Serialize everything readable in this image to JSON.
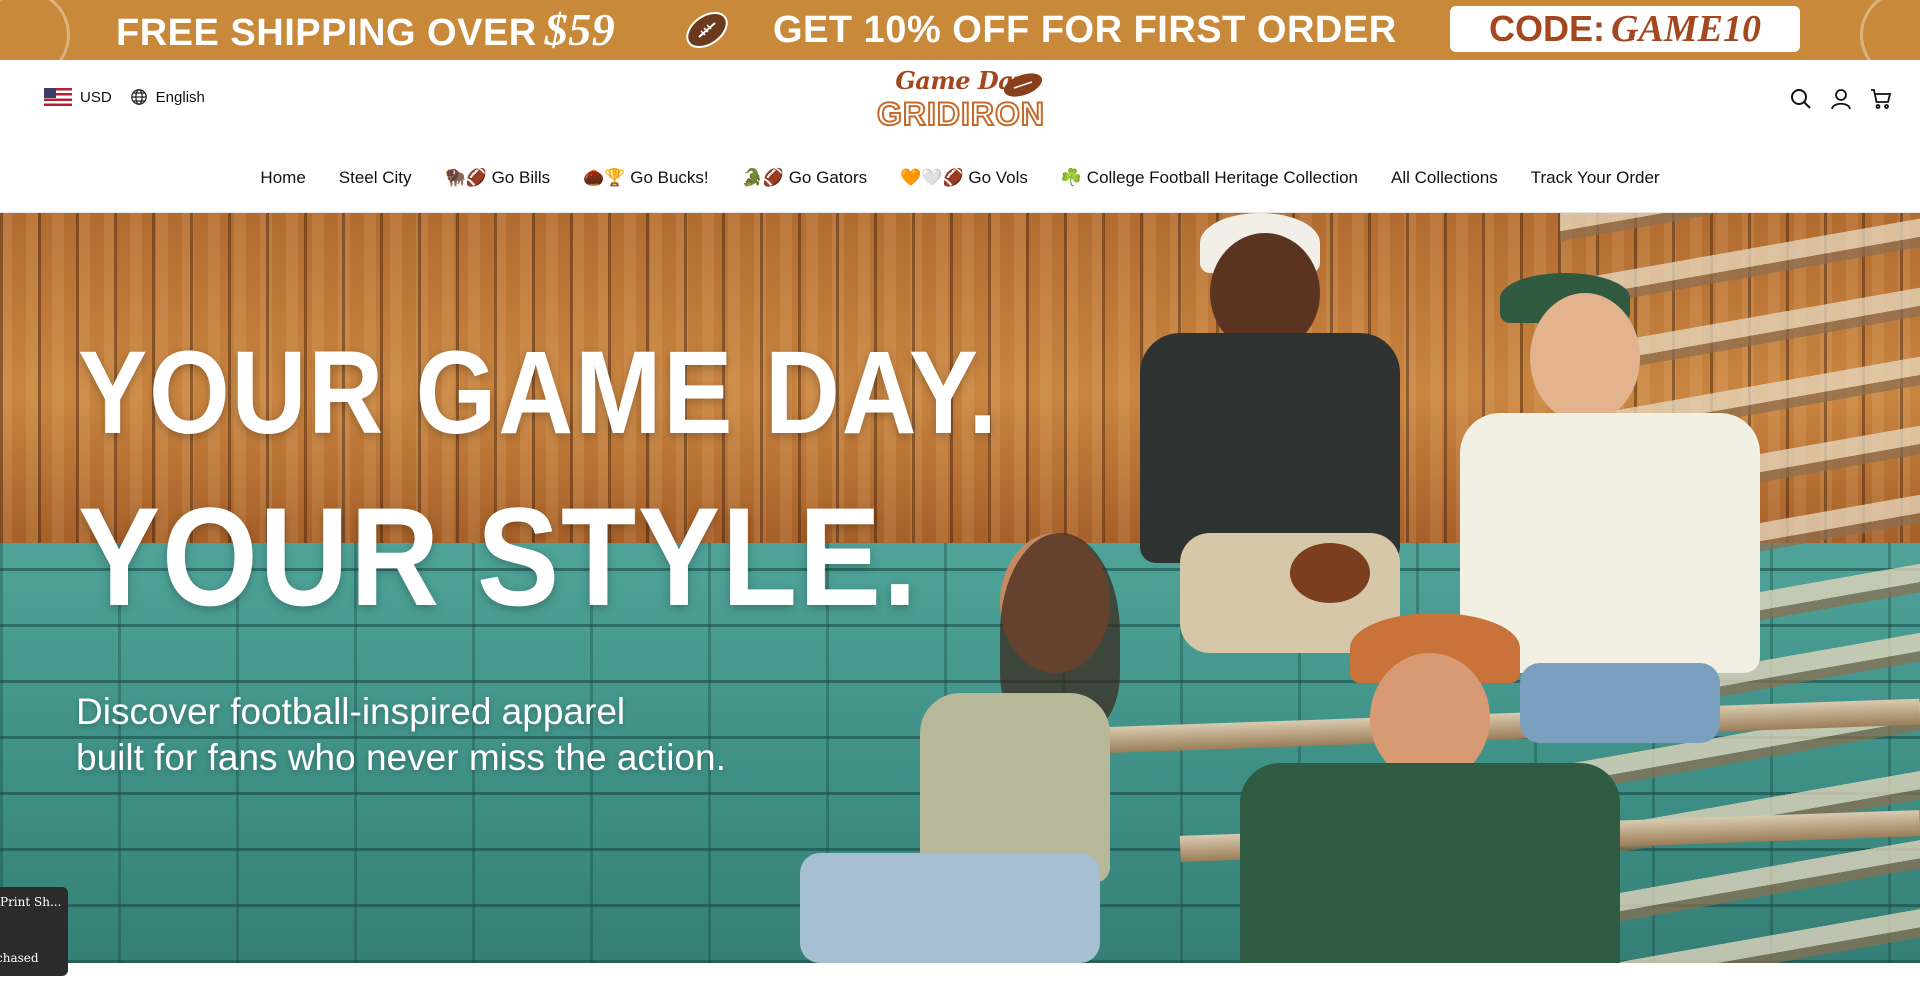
{
  "promo": {
    "shipping_text": "FREE SHIPPING OVER",
    "shipping_amount": "$59",
    "discount_text": "GET 10% OFF FOR FIRST ORDER",
    "code_label": "CODE:",
    "code_value": "GAME10"
  },
  "header": {
    "currency": "USD",
    "language": "English",
    "logo_script": "Game Day",
    "logo_word": "GRIDIRON"
  },
  "nav": {
    "items": [
      "Home",
      "Steel City",
      "🦬🏈 Go Bills",
      "🌰🏆 Go Bucks!",
      "🐊🏈 Go Gators",
      "🧡🤍🏈 Go Vols",
      "☘️ College Football Heritage Collection",
      "All Collections",
      "Track Your Order"
    ]
  },
  "hero": {
    "headline_1": "YOUR GAME DAY.",
    "headline_2": "YOUR STYLE.",
    "subtext_1": "Discover football-inspired apparel",
    "subtext_2": "built for fans who never miss the action."
  },
  "popup": {
    "line_1": "Print Sh...",
    "line_2": "chased"
  },
  "colors": {
    "promo_bg": "#c9893a",
    "brand_rust": "#a4471f",
    "hero_wall": "#3f8f86"
  },
  "icons": [
    "football-icon",
    "us-flag-icon",
    "globe-icon",
    "search-icon",
    "account-icon",
    "cart-icon"
  ]
}
